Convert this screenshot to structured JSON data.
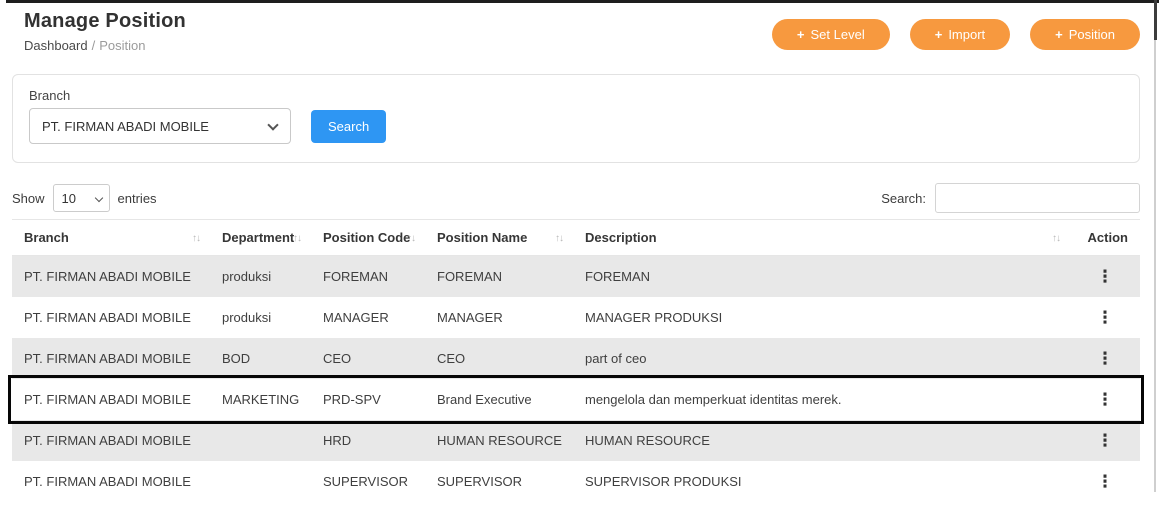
{
  "header": {
    "title": "Manage Position",
    "breadcrumb": [
      "Dashboard",
      "Position"
    ],
    "breadcrumb_separator": "/",
    "buttons": [
      {
        "label": "Set Level"
      },
      {
        "label": "Import"
      },
      {
        "label": "Position"
      }
    ]
  },
  "filter": {
    "branch_label": "Branch",
    "branch_selected": "PT. FIRMAN ABADI MOBILE",
    "search_button_label": "Search"
  },
  "table_controls": {
    "show_label": "Show",
    "entries_selected": "10",
    "entries_label": "entries",
    "search_label": "Search:",
    "search_value": ""
  },
  "table": {
    "columns": [
      {
        "label": "Branch",
        "sortable": true
      },
      {
        "label": "Department",
        "sortable": true
      },
      {
        "label": "Position Code",
        "sortable": true
      },
      {
        "label": "Position Name",
        "sortable": true
      },
      {
        "label": "Description",
        "sortable": true
      },
      {
        "label": "Action",
        "sortable": false
      }
    ],
    "rows": [
      {
        "branch": "PT. FIRMAN ABADI MOBILE",
        "department": "produksi",
        "position_code": "FOREMAN",
        "position_name": "FOREMAN",
        "description": "FOREMAN",
        "highlighted": false
      },
      {
        "branch": "PT. FIRMAN ABADI MOBILE",
        "department": "produksi",
        "position_code": "MANAGER",
        "position_name": "MANAGER",
        "description": "MANAGER PRODUKSI",
        "highlighted": false
      },
      {
        "branch": "PT. FIRMAN ABADI MOBILE",
        "department": "BOD",
        "position_code": "CEO",
        "position_name": "CEO",
        "description": "part of ceo",
        "highlighted": false
      },
      {
        "branch": "PT. FIRMAN ABADI MOBILE",
        "department": "MARKETING",
        "position_code": "PRD-SPV",
        "position_name": "Brand Executive",
        "description": "mengelola dan memperkuat identitas merek.",
        "highlighted": true
      },
      {
        "branch": "PT. FIRMAN ABADI MOBILE",
        "department": "",
        "position_code": "HRD",
        "position_name": "HUMAN RESOURCE",
        "description": "HUMAN RESOURCE",
        "highlighted": false
      },
      {
        "branch": "PT. FIRMAN ABADI MOBILE",
        "department": "",
        "position_code": "SUPERVISOR",
        "position_name": "SUPERVISOR",
        "description": "SUPERVISOR PRODUKSI",
        "highlighted": false
      }
    ]
  },
  "icons": {
    "plus": "+",
    "sort": "↑↓",
    "kebab": "⋮"
  },
  "colors": {
    "accent_orange": "#F7993F",
    "accent_blue": "#2E96F3",
    "row_stripe": "#E8E8E8",
    "highlight_border": "#000000"
  }
}
